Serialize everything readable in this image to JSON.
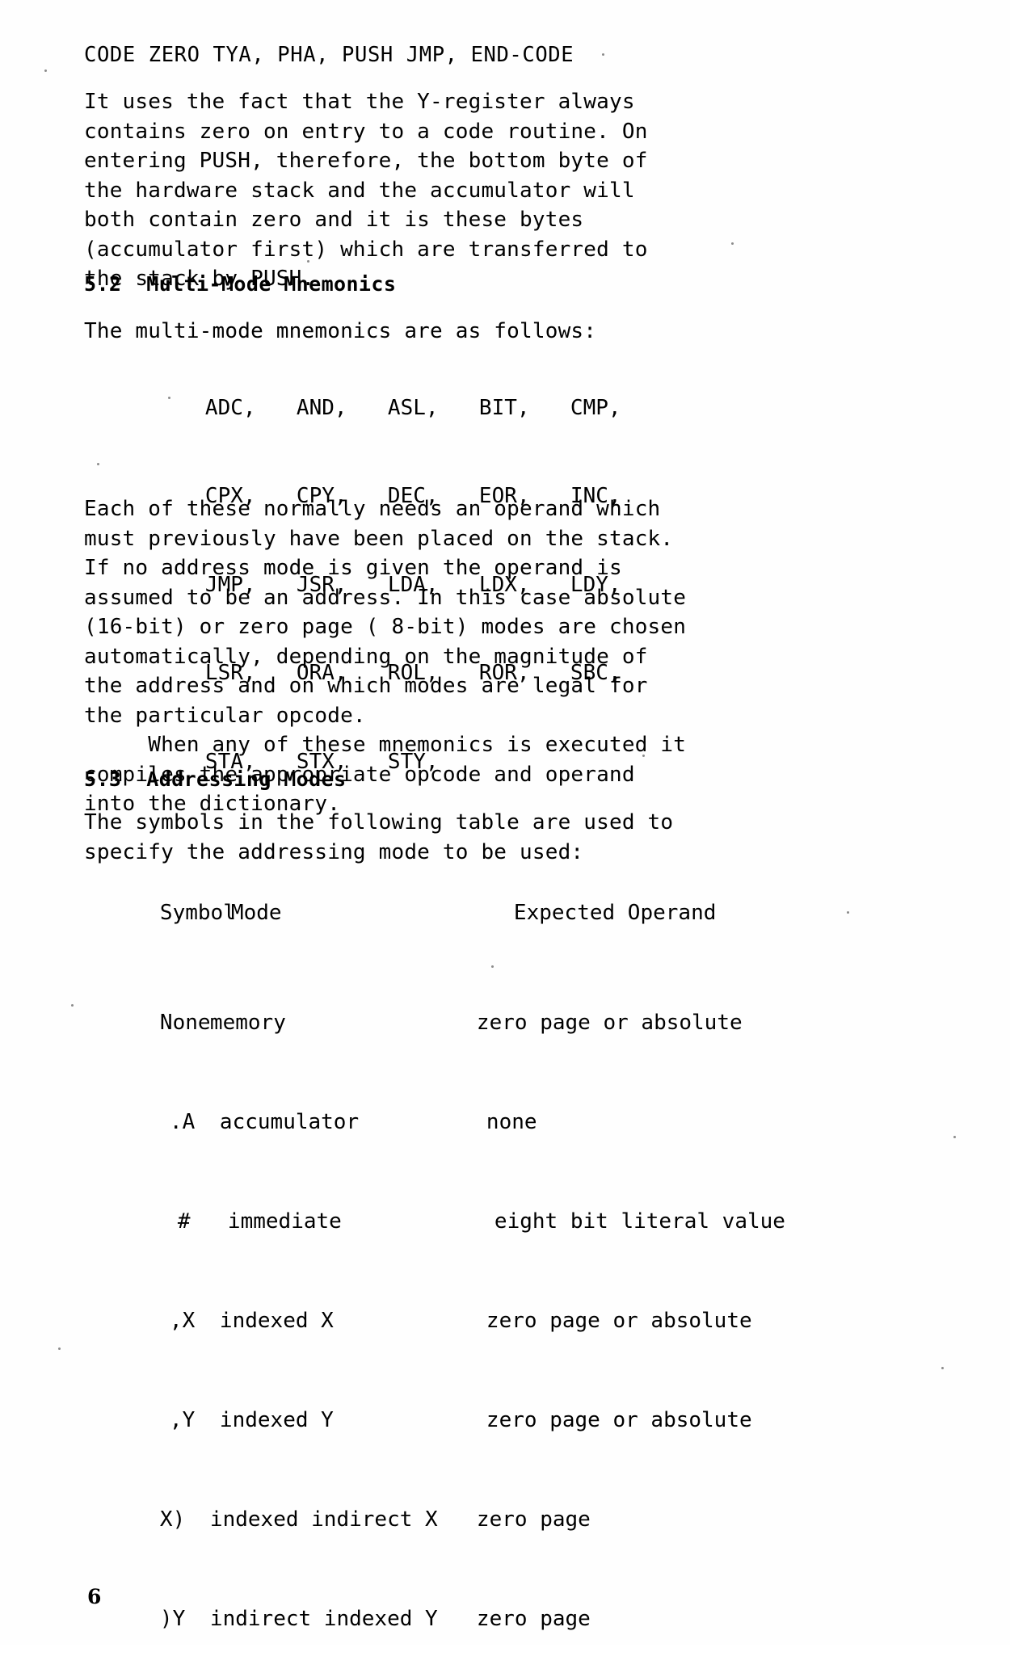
{
  "document": {
    "page_number": "6",
    "code_header_line": "CODE ZERO TYA, PHA, PUSH JMP, END-CODE"
  },
  "intro_paragraph": {
    "lines": [
      "It uses the fact that the Y-register always",
      "contains zero on entry to a code routine. On",
      "entering PUSH, therefore, the bottom byte of",
      "the hardware stack and the accumulator will",
      "both contain zero and it is these bytes",
      "(accumulator first) which are transferred to",
      "the stack by PUSH."
    ]
  },
  "section_52": {
    "number": "5.2",
    "title": "Multi-Mode Mnemonics",
    "heading": "5.2  Multi-Mode Mnemonics",
    "lead_in": "The multi-mode mnemonics are as follows:",
    "mnemonics_rows": [
      [
        "ADC,",
        "AND,",
        "ASL,",
        "BIT,",
        "CMP,"
      ],
      [
        "CPX,",
        "CPY,",
        "DEC,",
        "EOR,",
        "INC,"
      ],
      [
        "JMP,",
        "JSR,",
        "LDA,",
        "LDX,",
        "LDY,"
      ],
      [
        "LSR,",
        "ORA,",
        "ROL,",
        "ROR,",
        "SBC,"
      ],
      [
        "STA,",
        "STX,",
        "STY,",
        "",
        ""
      ]
    ],
    "body_lines": [
      "Each of these normally needs an operand which",
      "must previously have been placed on the stack.",
      "If no address mode is given the operand is",
      "assumed to be an address. In this case absolute",
      "(16-bit) or zero page ( 8-bit) modes are chosen",
      "automatically, depending on the magnitude of",
      "the address and on which modes are legal for",
      "the particular opcode.",
      "     When any of these mnemonics is executed it",
      "compiles the appropriate opcode and operand",
      "into the dictionary."
    ]
  },
  "section_53": {
    "number": "5.3",
    "title": "Addressing Modes",
    "heading": "5.3  Addressing Modes",
    "lead_lines": [
      "The symbols in the following table are used to",
      "specify the addressing mode to be used:"
    ],
    "table": {
      "headers": [
        "Symbol",
        "Mode",
        "Expected Operand"
      ],
      "rows": [
        {
          "symbol": "None",
          "mode": "memory",
          "operand": "zero page or absolute"
        },
        {
          "symbol": ".A",
          "mode": "accumulator",
          "operand": "none"
        },
        {
          "symbol": "#",
          "mode": "immediate",
          "operand": "eight bit literal value"
        },
        {
          "symbol": ",X",
          "mode": "indexed X",
          "operand": "zero page or absolute"
        },
        {
          "symbol": ",Y",
          "mode": "indexed Y",
          "operand": "zero page or absolute"
        },
        {
          "symbol": "X)",
          "mode": "indexed indirect X",
          "operand": "zero page"
        },
        {
          "symbol": ")Y",
          "mode": "indirect indexed Y",
          "operand": "zero page"
        }
      ]
    }
  },
  "colors": {
    "ink": "#000000",
    "paper": "#ffffff"
  }
}
